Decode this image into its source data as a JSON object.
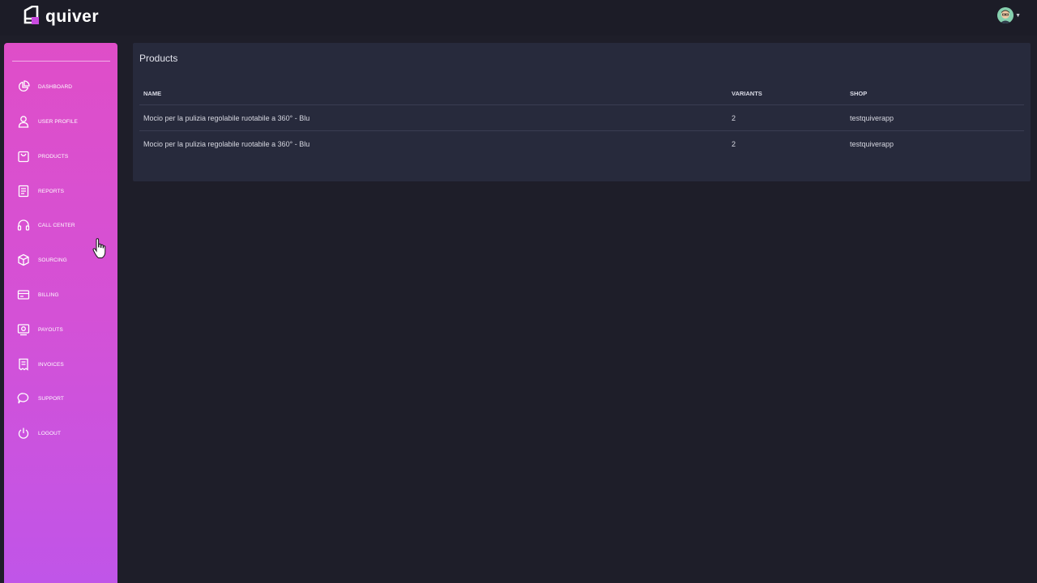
{
  "app": {
    "logo_text": "quiver",
    "brand_color": "#d64fd3"
  },
  "sidebar": {
    "items": [
      {
        "label": "DASHBOARD",
        "icon": "pie-chart-icon"
      },
      {
        "label": "USER PROFILE",
        "icon": "user-icon"
      },
      {
        "label": "PRODUCTS",
        "icon": "bag-icon"
      },
      {
        "label": "REPORTS",
        "icon": "document-icon"
      },
      {
        "label": "CALL CENTER",
        "icon": "headphones-icon"
      },
      {
        "label": "SOURCING",
        "icon": "box-icon"
      },
      {
        "label": "BILLING",
        "icon": "credit-card-icon"
      },
      {
        "label": "PAYOUTS",
        "icon": "money-icon"
      },
      {
        "label": "INVOICES",
        "icon": "invoice-icon"
      },
      {
        "label": "SUPPORT",
        "icon": "chat-icon"
      },
      {
        "label": "LOGOUT",
        "icon": "power-icon"
      }
    ]
  },
  "main": {
    "title": "Products",
    "table": {
      "columns": [
        "NAME",
        "VARIANTS",
        "SHOP"
      ],
      "rows": [
        {
          "name": "Mocio per la pulizia regolabile ruotabile a 360° - Blu",
          "variants": "2",
          "shop": "testquiverapp"
        },
        {
          "name": "Mocio per la pulizia regolabile ruotabile a 360° - Blu",
          "variants": "2",
          "shop": "testquiverapp"
        }
      ]
    }
  }
}
